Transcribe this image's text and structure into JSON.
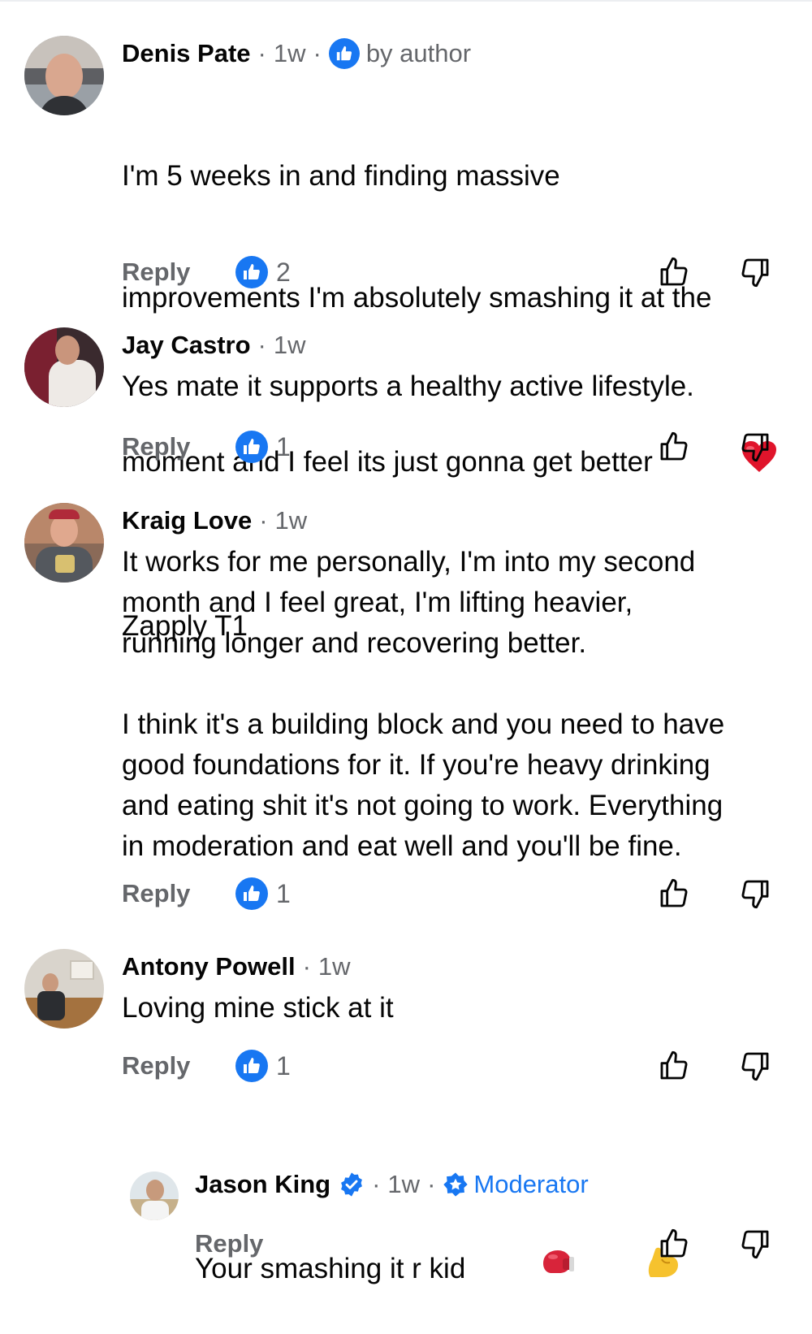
{
  "colors": {
    "accent": "#1877f2",
    "secondary_text": "#65676b",
    "primary_text": "#050505",
    "heart": "#e0142b"
  },
  "comments": [
    {
      "author": "Denis Pate",
      "time": "1w",
      "badge": "by author",
      "text_lines": [
        "I'm 5 weeks in and finding massive",
        "improvements I'm absolutely smashing it at the",
        "moment and I feel its just gonna get better",
        "Zapply T1"
      ],
      "reply_label": "Reply",
      "like_count": "2"
    },
    {
      "author": "Jay Castro",
      "time": "1w",
      "text": "Yes mate it supports a healthy active lifestyle.",
      "reply_label": "Reply",
      "like_count": "1"
    },
    {
      "author": "Kraig Love",
      "time": "1w",
      "text": "It works for me personally, I'm into my second\nmonth and I feel great, I'm lifting heavier,\nrunning longer and recovering better.\n\nI think it's a building block and you need to have\ngood foundations for it. If you're heavy drinking\nand eating shit it's not going to work. Everything\nin moderation and eat well and you'll be fine.",
      "reply_label": "Reply",
      "like_count": "1"
    },
    {
      "author": "Antony Powell",
      "time": "1w",
      "text": "Loving mine stick at it",
      "reply_label": "Reply",
      "like_count": "1"
    }
  ],
  "reply": {
    "author": "Jason King",
    "time": "1w",
    "badge": "Moderator",
    "text": "Your smashing it r kid",
    "reply_label": "Reply"
  }
}
